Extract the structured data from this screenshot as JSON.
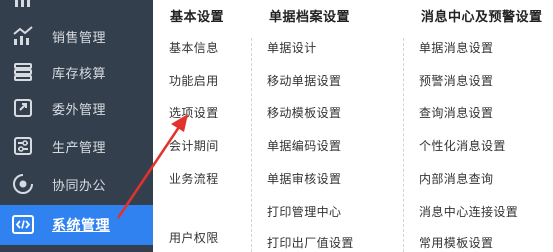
{
  "sidebar": {
    "items": [
      {
        "label": "",
        "icon": "chart-icon",
        "clipped": true
      },
      {
        "label": "销售管理",
        "icon": "sales-chart-icon"
      },
      {
        "label": "库存核算",
        "icon": "inventory-icon"
      },
      {
        "label": "委外管理",
        "icon": "outsourcing-icon"
      },
      {
        "label": "生产管理",
        "icon": "production-icon"
      },
      {
        "label": "协同办公",
        "icon": "collaboration-icon"
      },
      {
        "label": "系统管理",
        "icon": "code-icon",
        "active": true
      }
    ],
    "active_color": "#2f82f0",
    "background": "#343f4d"
  },
  "panel": {
    "columns": [
      {
        "title": "基本设置",
        "links": [
          "基本信息",
          "功能启用",
          "选项设置",
          "会计期间",
          "业务流程",
          "用户权限"
        ]
      },
      {
        "title": "单据档案设置",
        "links": [
          "单据设计",
          "移动单据设置",
          "移动模板设置",
          "单据编码设置",
          "单据审核设置",
          "打印管理中心",
          "打印出厂值设置"
        ]
      },
      {
        "title": "消息中心及预警设置",
        "links": [
          "单据消息设置",
          "预警消息设置",
          "查询消息设置",
          "个性化消息设置",
          "内部消息查询",
          "消息中心连接设置",
          "常用模板设置"
        ]
      }
    ]
  },
  "annotation": {
    "arrow_color": "#e3322b",
    "target": "选项设置"
  }
}
